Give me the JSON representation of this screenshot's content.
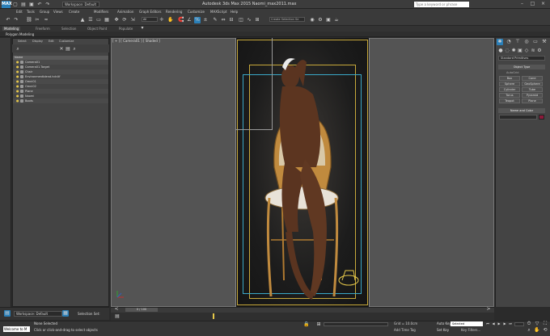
{
  "window": {
    "title": "Autodesk 3ds Max  2015        Naomi_max2011.max",
    "logo": "MAX",
    "workspace": "Workspace: Default",
    "search_placeholder": "Type a keyword or phrase",
    "minimize": "–",
    "maximize": "□",
    "close": "×"
  },
  "menu": [
    "Edit",
    "Tools",
    "Group",
    "Views",
    "Create",
    "Modifiers",
    "Animation",
    "Graph Editors",
    "Rendering",
    "Customize",
    "MAXScript",
    "Help"
  ],
  "toolbar": {
    "selection_filter": "All",
    "view_dd": "View",
    "named_selection": "Create Selection Se"
  },
  "ribbon": {
    "tabs": [
      "Modeling",
      "Freeform",
      "Selection",
      "Object Paint",
      "Populate"
    ],
    "active_tab": "Modeling",
    "sub_label": "Polygon Modeling"
  },
  "explorer": {
    "menu": [
      "Select",
      "Display",
      "Edit",
      "Customize"
    ],
    "header": "Name",
    "rows": [
      "Camera01",
      "Camera01.Target",
      "Chair",
      "Environmentblend.hdr.tif",
      "Omni01",
      "Omni02",
      "Plane",
      "Naomi",
      "Boots"
    ]
  },
  "explorer_bottom": {
    "layer": "Workspace: Default",
    "selection_set": "Selection Set:"
  },
  "viewport": {
    "label": "[ + ] [ Camera01 ] [ Shaded ]"
  },
  "command_panel": {
    "category": "Standard Primitives",
    "object_type_title": "Object Type",
    "autogrid": "AutoGrid",
    "buttons": [
      "Box",
      "Cone",
      "Sphere",
      "GeoSphere",
      "Cylinder",
      "Tube",
      "Torus",
      "Pyramid",
      "Teapot",
      "Plane"
    ],
    "name_color_title": "Name and Color"
  },
  "timeline": {
    "slider": "0 / 100"
  },
  "status": {
    "maxscript": "Welcome to M",
    "selected": "None Selected",
    "prompt": "Click or click-and-drag to select objects",
    "coords": "Grid = 10.0cm",
    "add_time_tag": "Add Time Tag",
    "auto_key": "Auto Key",
    "set_key": "Set Key",
    "selected_dd": "Selected",
    "key_filters": "Key Filters..."
  },
  "colors": {
    "accent": "#2a7fb8",
    "key_yellow": "#e6c84a",
    "safe_frame_yellow": "#c8a93a",
    "safe_frame_cyan": "#3aa8c8",
    "object_color": "#8b1a3a"
  }
}
